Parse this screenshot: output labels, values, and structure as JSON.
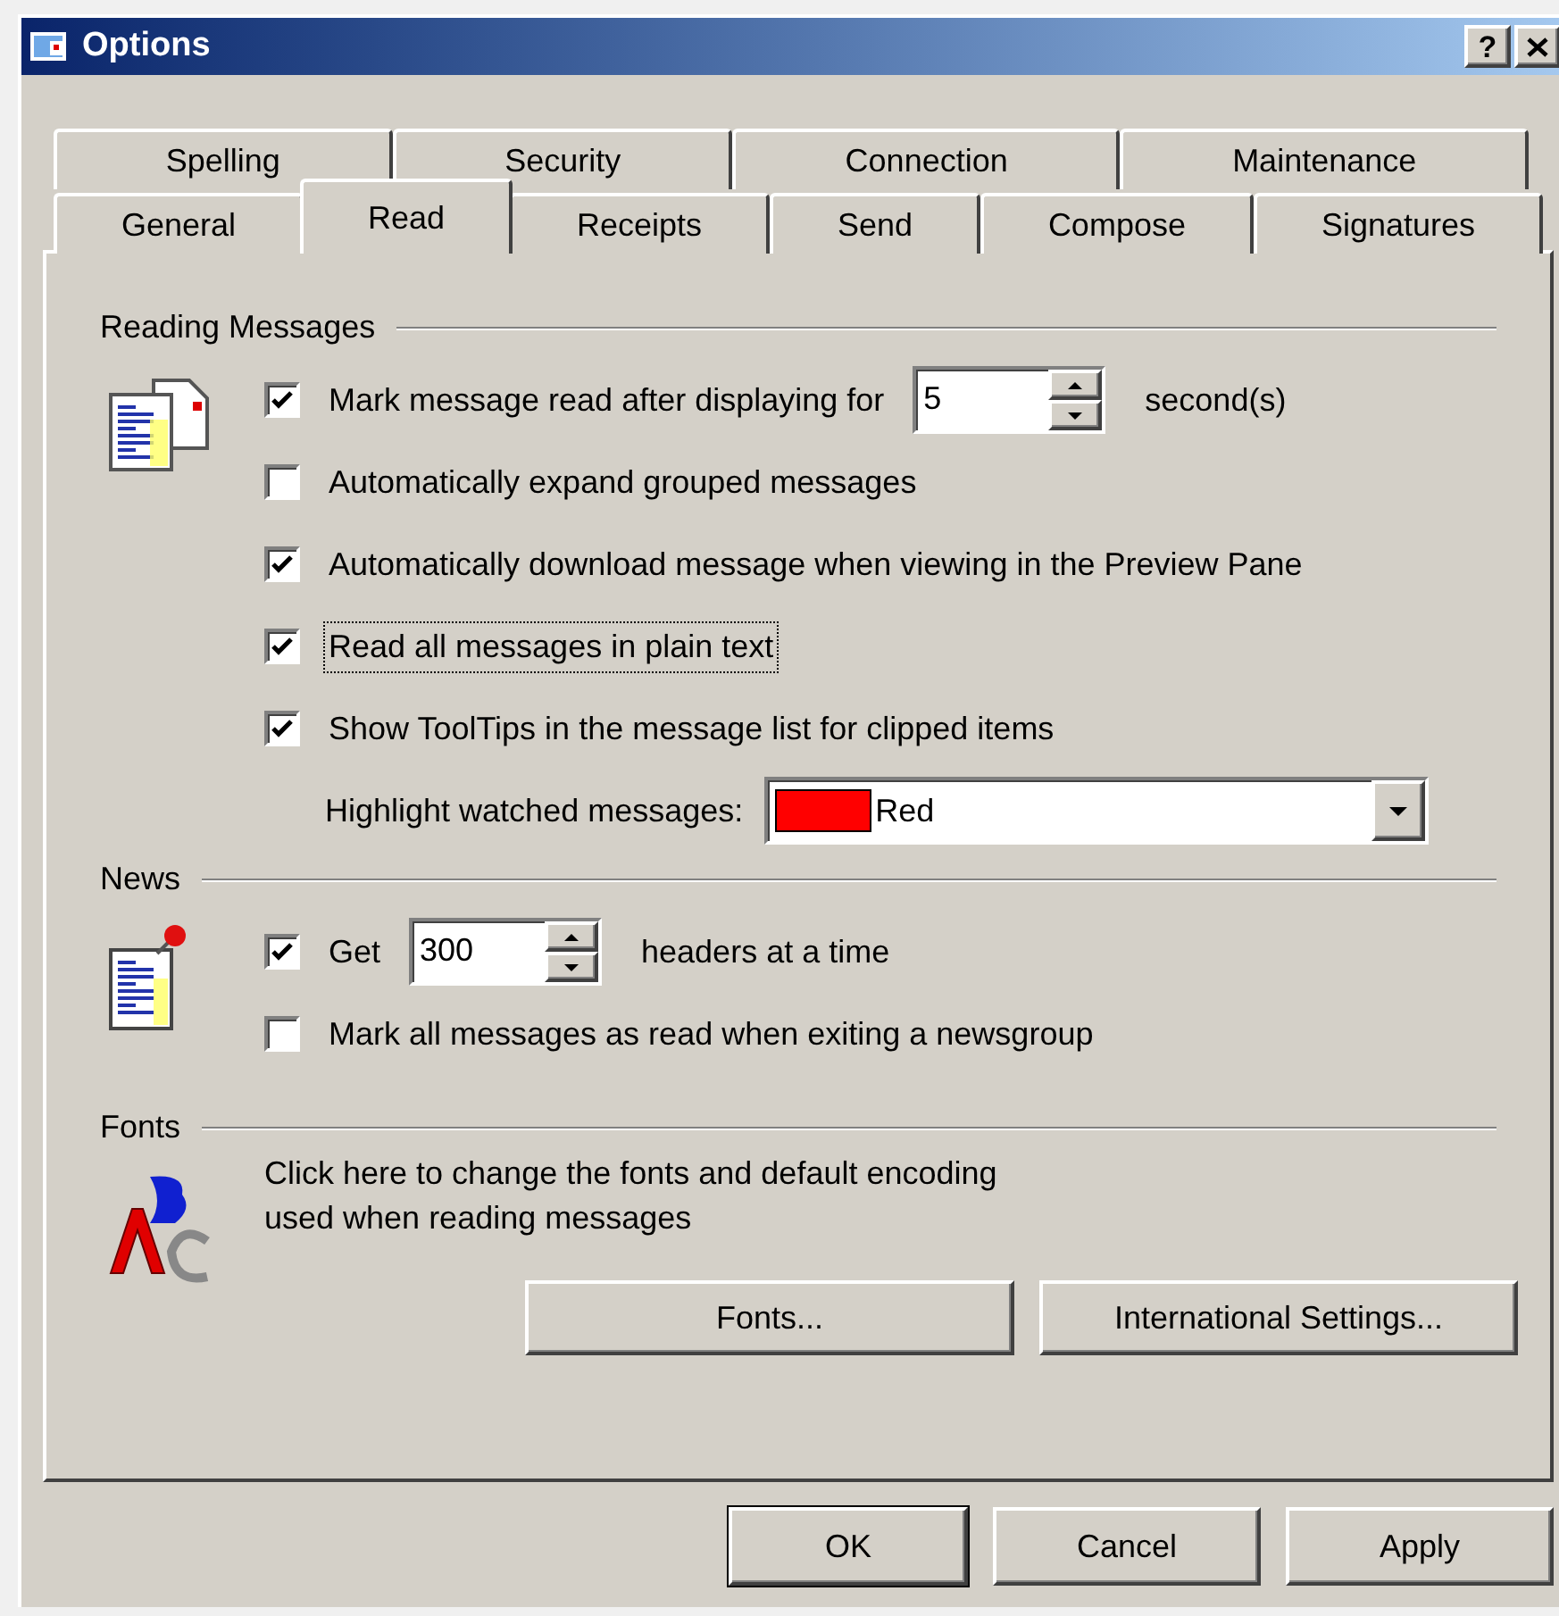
{
  "window": {
    "title": "Options",
    "help_label": "?"
  },
  "tab_rows": [
    [
      {
        "label": "Spelling",
        "selected": false
      },
      {
        "label": "Security",
        "selected": false
      },
      {
        "label": "Connection",
        "selected": false
      },
      {
        "label": "Maintenance",
        "selected": false
      }
    ],
    [
      {
        "label": "General",
        "selected": false
      },
      {
        "label": "Read",
        "selected": true
      },
      {
        "label": "Receipts",
        "selected": false
      },
      {
        "label": "Send",
        "selected": false
      },
      {
        "label": "Compose",
        "selected": false
      },
      {
        "label": "Signatures",
        "selected": false
      }
    ]
  ],
  "sections": [
    {
      "title": "Reading Messages",
      "kind": "messages",
      "items": [
        {
          "kind": "checkbox_spin",
          "label": "Mark message read after displaying for",
          "checked": true,
          "value": "5",
          "suffix": "second(s)",
          "focused": false
        },
        {
          "kind": "checkbox",
          "label": "Automatically expand grouped messages",
          "checked": false,
          "focused": false
        },
        {
          "kind": "checkbox",
          "label": "Automatically download message when viewing in the Preview Pane",
          "checked": true,
          "focused": false
        },
        {
          "kind": "checkbox",
          "label": "Read all messages in plain text",
          "checked": true,
          "focused": true
        },
        {
          "kind": "checkbox",
          "label": "Show ToolTips in the message list for clipped items",
          "checked": true,
          "focused": false
        },
        {
          "kind": "dropdown",
          "label": "Highlight watched messages:",
          "value": "Red",
          "color": "#ff0000"
        }
      ]
    },
    {
      "title": "News",
      "kind": "news",
      "items": [
        {
          "kind": "checkbox_spin",
          "label": "Get",
          "checked": true,
          "value": "300",
          "suffix": "headers at a time",
          "focused": false
        },
        {
          "kind": "checkbox",
          "label": "Mark all messages as read when exiting a newsgroup",
          "checked": false,
          "focused": false
        }
      ]
    },
    {
      "title": "Fonts",
      "kind": "fonts",
      "items": [
        {
          "kind": "text",
          "label": "Click here to change the fonts and default encoding\nused when reading messages"
        },
        {
          "kind": "buttons",
          "buttons": [
            "Fonts...",
            "International Settings..."
          ]
        }
      ]
    }
  ],
  "buttons": [
    "OK",
    "Cancel",
    "Apply"
  ]
}
